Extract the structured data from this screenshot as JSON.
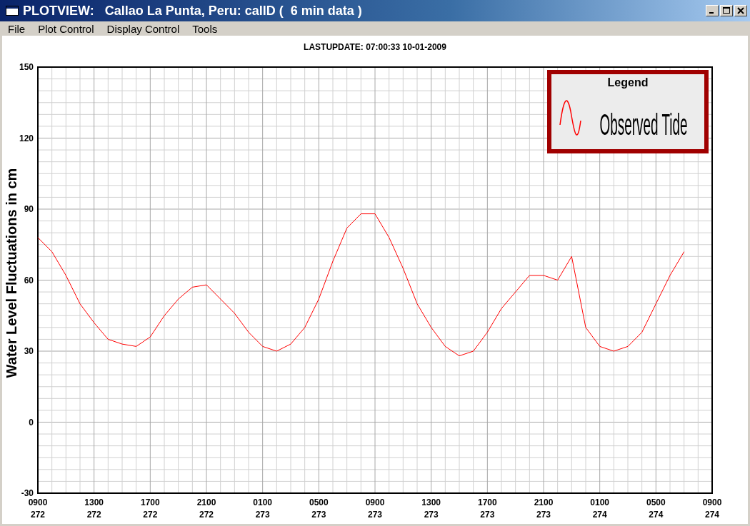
{
  "window": {
    "title": "PLOTVIEW:   Callao La Punta, Peru: callD (  6 min data )"
  },
  "menu": [
    "File",
    "Plot Control",
    "Display Control",
    "Tools"
  ],
  "last_update": "LASTUPDATE: 07:00:33  10-01-2009",
  "plot": {
    "chart_data": {
      "type": "line",
      "ylabel": "Water Level Fluctuations in cm",
      "legend_title": "Legend",
      "categories": [
        "0900\n272",
        null,
        null,
        null,
        "1300\n272",
        null,
        null,
        null,
        "1700\n272",
        null,
        null,
        null,
        "2100\n272",
        null,
        null,
        null,
        "0100\n273",
        null,
        null,
        null,
        "0500\n273",
        null,
        null,
        null,
        "0900\n273",
        null,
        null,
        null,
        "1300\n273",
        null,
        null,
        null,
        "1700\n273",
        null,
        null,
        null,
        "2100\n273",
        null,
        null,
        null,
        "0100\n274",
        null,
        null,
        null,
        "0500\n274",
        null,
        null,
        null,
        "0900\n274"
      ],
      "series": [
        {
          "name": "Observed Tide",
          "color": "#ff0000",
          "values": [
            78,
            72,
            62,
            50,
            42,
            35,
            33,
            32,
            36,
            45,
            52,
            57,
            58,
            52,
            46,
            38,
            32,
            30,
            33,
            40,
            52,
            68,
            82,
            88,
            88,
            78,
            65,
            50,
            40,
            32,
            28,
            30,
            38,
            48,
            55,
            62,
            62,
            60,
            70,
            40,
            32,
            30,
            32,
            38,
            50,
            62,
            72,
            null,
            null
          ]
        }
      ],
      "grid": true,
      "ylim": [
        -30,
        150
      ],
      "yticks": [
        -30,
        0,
        30,
        60,
        90,
        120,
        150
      ]
    }
  }
}
